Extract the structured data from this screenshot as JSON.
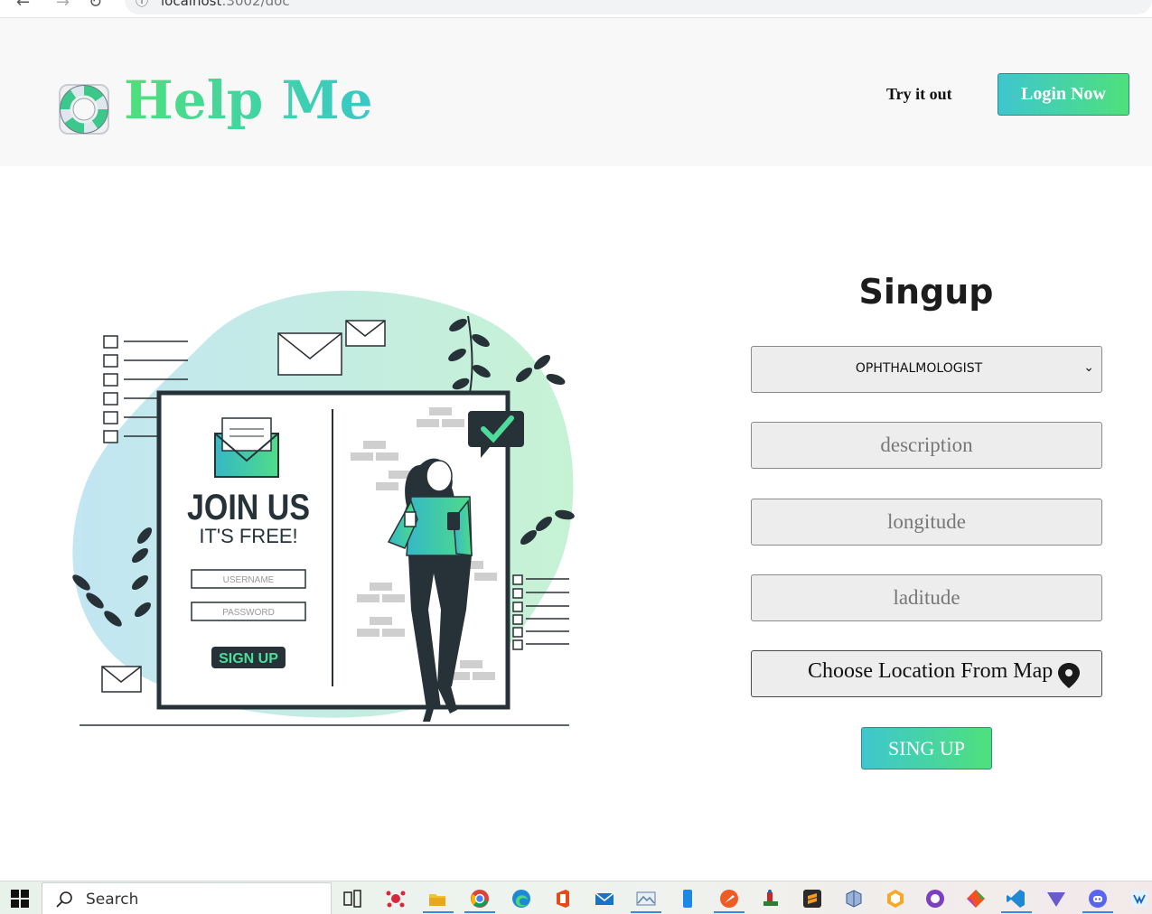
{
  "browser": {
    "url_host": "localhost",
    "url_rest": ":3002/doc"
  },
  "header": {
    "brand": "Help Me",
    "try_link": "Try it out",
    "login_button": "Login Now"
  },
  "illustration": {
    "join_us": "JOIN US",
    "its_free": "IT'S FREE!",
    "username_placeholder": "USERNAME",
    "password_placeholder": "PASSWORD",
    "signup_button": "SIGN UP"
  },
  "form": {
    "title": "Singup",
    "specialty_selected": "OPHTHALMOLOGIST",
    "description_placeholder": "description",
    "longitude_placeholder": "longitude",
    "latitude_placeholder": "laditude",
    "map_button": "Choose Location From Map",
    "submit_button": "SING UP"
  },
  "taskbar": {
    "search_label": "Search",
    "icons": [
      "task-view-icon",
      "app-red-icon",
      "file-explorer-icon",
      "chrome-icon",
      "edge-icon",
      "office-icon",
      "mail-icon",
      "photos-icon",
      "phone-link-icon",
      "postman-icon",
      "app-figure-icon",
      "sublime-text-icon",
      "virtualbox-icon",
      "hexagon-app-icon",
      "github-desktop-icon",
      "git-icon",
      "vscode-icon",
      "prism-icon",
      "discord-icon",
      "app-small-icon"
    ]
  },
  "colors": {
    "accent_green": "#4fe07c",
    "accent_teal": "#3ec6cf",
    "header_bg": "#f8f8f8",
    "field_bg": "#ededed"
  }
}
